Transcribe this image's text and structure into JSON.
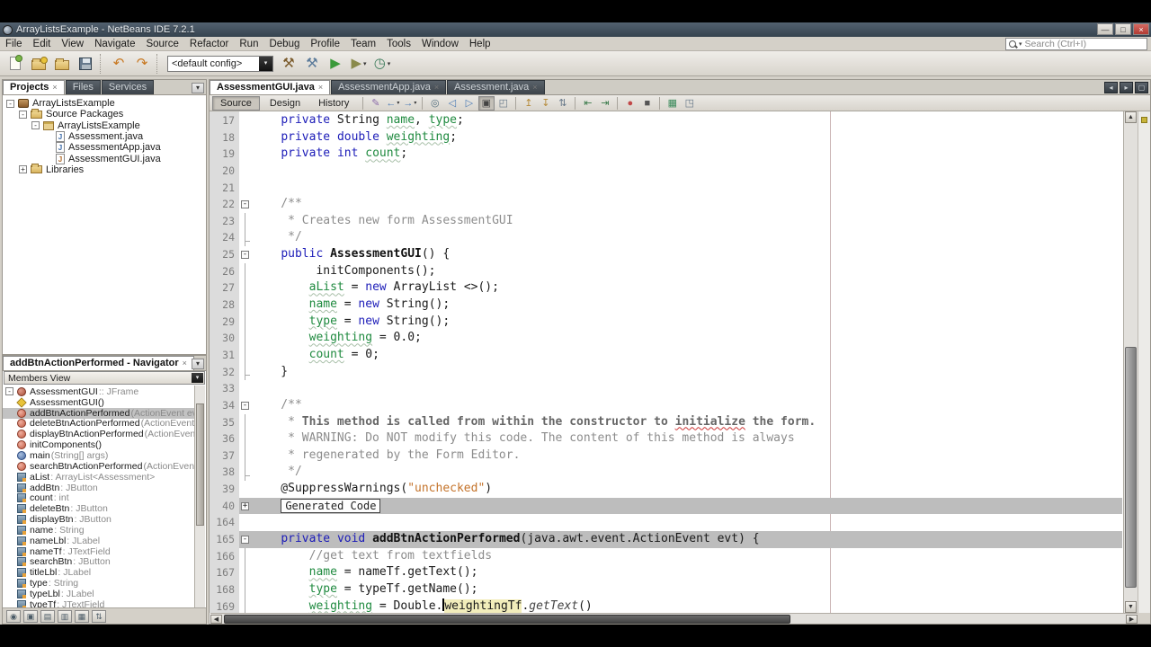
{
  "window": {
    "title": "ArrayListsExample - NetBeans IDE 7.2.1",
    "controls": {
      "minimize": "—",
      "restore": "□",
      "close": "×"
    }
  },
  "menu": {
    "items": [
      "File",
      "Edit",
      "View",
      "Navigate",
      "Source",
      "Refactor",
      "Run",
      "Debug",
      "Profile",
      "Team",
      "Tools",
      "Window",
      "Help"
    ]
  },
  "search": {
    "placeholder": "Search (Ctrl+I)"
  },
  "toolbar": {
    "config_value": "<default config>",
    "buttons": [
      {
        "name": "new-file",
        "css": "ci-newfile"
      },
      {
        "name": "new-project",
        "css": "ci-folder ci-newproj"
      },
      {
        "name": "open-project",
        "css": "ci-folder"
      },
      {
        "name": "save-all",
        "css": "ci-save"
      },
      {
        "sep": true
      },
      {
        "name": "undo",
        "glyph": "↶",
        "color": "#c87820"
      },
      {
        "name": "redo",
        "glyph": "↷",
        "color": "#c87820"
      },
      {
        "sep": true
      },
      {
        "config": true
      },
      {
        "name": "build-project",
        "glyph": "⚒",
        "color": "#7a5a2a"
      },
      {
        "name": "clean-build-project",
        "glyph": "⚒",
        "color": "#5a7a9a"
      },
      {
        "name": "run-project",
        "glyph": "▶",
        "color": "#3a9a3a"
      },
      {
        "name": "debug-project",
        "glyph": "▶",
        "color": "#8a8a4a",
        "dd": true
      },
      {
        "name": "profile-project",
        "glyph": "◷",
        "color": "#3a7a5a",
        "dd": true
      }
    ]
  },
  "projects_panel": {
    "tabs": [
      {
        "label": "Projects",
        "active": true
      },
      {
        "label": "Files",
        "active": false
      },
      {
        "label": "Services",
        "active": false
      }
    ],
    "tree": [
      {
        "label": "ArrayListsExample",
        "icon": "project",
        "depth": 0,
        "exp": "-"
      },
      {
        "label": "Source Packages",
        "icon": "folder",
        "depth": 1,
        "exp": "-"
      },
      {
        "label": "ArrayListsExample",
        "icon": "package",
        "depth": 2,
        "exp": "-"
      },
      {
        "label": "Assessment.java",
        "icon": "java",
        "depth": 3,
        "exp": null
      },
      {
        "label": "AssessmentApp.java",
        "icon": "java",
        "depth": 3,
        "exp": null
      },
      {
        "label": "AssessmentGUI.java",
        "icon": "java-form",
        "depth": 3,
        "exp": null
      },
      {
        "label": "Libraries",
        "icon": "folder",
        "depth": 1,
        "exp": "+"
      }
    ]
  },
  "navigator_panel": {
    "title": "addBtnActionPerformed - Navigator",
    "view_select": "Members View",
    "items": [
      {
        "name": "AssessmentGUI",
        "detail": " :: JFrame",
        "icon": "class",
        "depth": 0,
        "exp": "-",
        "selected": false
      },
      {
        "name": "AssessmentGUI()",
        "detail": "",
        "icon": "ctor",
        "depth": 1,
        "selected": false
      },
      {
        "name": "addBtnActionPerformed",
        "detail": "(ActionEvent evt)",
        "icon": "method",
        "depth": 1,
        "selected": true
      },
      {
        "name": "deleteBtnActionPerformed",
        "detail": "(ActionEvent evt)",
        "icon": "method",
        "depth": 1,
        "selected": false
      },
      {
        "name": "displayBtnActionPerformed",
        "detail": "(ActionEvent evt)",
        "icon": "method",
        "depth": 1,
        "selected": false
      },
      {
        "name": "initComponents()",
        "detail": "",
        "icon": "method",
        "depth": 1,
        "selected": false
      },
      {
        "name": "main",
        "detail": "(String[] args)",
        "icon": "method-static",
        "depth": 1,
        "selected": false
      },
      {
        "name": "searchBtnActionPerformed",
        "detail": "(ActionEvent evt)",
        "icon": "method",
        "depth": 1,
        "selected": false
      },
      {
        "name": "aList",
        "detail": " : ArrayList<Assessment>",
        "icon": "field",
        "depth": 1,
        "selected": false
      },
      {
        "name": "addBtn",
        "detail": " : JButton",
        "icon": "field",
        "depth": 1,
        "selected": false
      },
      {
        "name": "count",
        "detail": " : int",
        "icon": "field",
        "depth": 1,
        "selected": false
      },
      {
        "name": "deleteBtn",
        "detail": " : JButton",
        "icon": "field",
        "depth": 1,
        "selected": false
      },
      {
        "name": "displayBtn",
        "detail": " : JButton",
        "icon": "field",
        "depth": 1,
        "selected": false
      },
      {
        "name": "name",
        "detail": " : String",
        "icon": "field",
        "depth": 1,
        "selected": false
      },
      {
        "name": "nameLbl",
        "detail": " : JLabel",
        "icon": "field",
        "depth": 1,
        "selected": false
      },
      {
        "name": "nameTf",
        "detail": " : JTextField",
        "icon": "field",
        "depth": 1,
        "selected": false
      },
      {
        "name": "searchBtn",
        "detail": " : JButton",
        "icon": "field",
        "depth": 1,
        "selected": false
      },
      {
        "name": "titleLbl",
        "detail": " : JLabel",
        "icon": "field",
        "depth": 1,
        "selected": false
      },
      {
        "name": "type",
        "detail": " : String",
        "icon": "field",
        "depth": 1,
        "selected": false
      },
      {
        "name": "typeLbl",
        "detail": " : JLabel",
        "icon": "field",
        "depth": 1,
        "selected": false
      },
      {
        "name": "typeTf",
        "detail": " : JTextField",
        "icon": "field",
        "depth": 1,
        "selected": false
      }
    ],
    "filters": [
      {
        "name": "show-inherited-filter",
        "glyph": "◉"
      },
      {
        "name": "show-fields-filter",
        "glyph": "▣"
      },
      {
        "name": "show-static-filter",
        "glyph": "▤"
      },
      {
        "name": "show-public-filter",
        "glyph": "▥"
      },
      {
        "name": "show-non-public-filter",
        "glyph": "▦"
      },
      {
        "name": "sort-by-name",
        "glyph": "⇅"
      }
    ]
  },
  "editor": {
    "tabs": [
      {
        "label": "AssessmentGUI.java",
        "active": true
      },
      {
        "label": "AssessmentApp.java",
        "active": false
      },
      {
        "label": "Assessment.java",
        "active": false
      }
    ],
    "tab_buttons": [
      {
        "name": "scroll-tabs-left-button",
        "glyph": "◂"
      },
      {
        "name": "scroll-tabs-right-button",
        "glyph": "▸"
      },
      {
        "name": "maximize-window-button",
        "glyph": "▢"
      }
    ],
    "views": [
      {
        "label": "Source",
        "active": true
      },
      {
        "label": "Design",
        "active": false
      },
      {
        "label": "History",
        "active": false
      }
    ],
    "toolbar_icons": [
      {
        "name": "last-edit-location",
        "glyph": "✎",
        "color": "#8a6aa8"
      },
      {
        "name": "back",
        "glyph": "←",
        "color": "#4a7ab5",
        "dd": true
      },
      {
        "name": "forward",
        "glyph": "→",
        "color": "#4a7ab5",
        "dd": true
      },
      {
        "sep": true
      },
      {
        "name": "find-selection",
        "glyph": "◎",
        "color": "#55707f"
      },
      {
        "name": "find-previous",
        "glyph": "◁",
        "color": "#4a7ab5"
      },
      {
        "name": "find-next",
        "glyph": "▷",
        "color": "#4a7ab5"
      },
      {
        "name": "toggle-highlight-search",
        "glyph": "▣",
        "color": "#444",
        "pressed": true
      },
      {
        "name": "select-in-projects",
        "glyph": "◰",
        "color": "#667788"
      },
      {
        "sep": true
      },
      {
        "name": "previous-bookmark",
        "glyph": "↥",
        "color": "#b58a3a"
      },
      {
        "name": "next-bookmark",
        "glyph": "↧",
        "color": "#b58a3a"
      },
      {
        "name": "toggle-bookmark",
        "glyph": "⇅",
        "color": "#667788"
      },
      {
        "sep": true
      },
      {
        "name": "shift-line-left",
        "glyph": "⇤",
        "color": "#3a7a4a"
      },
      {
        "name": "shift-line-right",
        "glyph": "⇥",
        "color": "#3a7a4a"
      },
      {
        "sep": true
      },
      {
        "name": "record-macro",
        "glyph": "●",
        "color": "#c14848"
      },
      {
        "name": "stop-macro",
        "glyph": "■",
        "color": "#555555"
      },
      {
        "sep": true
      },
      {
        "name": "diff-to-tracked",
        "glyph": "▦",
        "color": "#3a8a5a"
      },
      {
        "name": "split-document",
        "glyph": "◳",
        "color": "#667788"
      }
    ],
    "code": {
      "lines": [
        {
          "n": 17,
          "seg": [
            [
              "    ",
              "p"
            ],
            [
              "private",
              "kw"
            ],
            [
              " String ",
              "p"
            ],
            [
              "name",
              "fld"
            ],
            [
              ", ",
              "p"
            ],
            [
              "type",
              "fld"
            ],
            [
              ";",
              "p"
            ]
          ]
        },
        {
          "n": 18,
          "seg": [
            [
              "    ",
              "p"
            ],
            [
              "private",
              "kw"
            ],
            [
              " ",
              "p"
            ],
            [
              "double",
              "kw"
            ],
            [
              " ",
              "p"
            ],
            [
              "weighting",
              "fld"
            ],
            [
              ";",
              "p"
            ]
          ]
        },
        {
          "n": 19,
          "seg": [
            [
              "    ",
              "p"
            ],
            [
              "private",
              "kw"
            ],
            [
              " ",
              "p"
            ],
            [
              "int",
              "kw"
            ],
            [
              " ",
              "p"
            ],
            [
              "count",
              "fld"
            ],
            [
              ";",
              "p"
            ]
          ]
        },
        {
          "n": 20,
          "seg": []
        },
        {
          "n": 21,
          "seg": []
        },
        {
          "n": 22,
          "f": "o",
          "seg": [
            [
              "    /**",
              "cmt"
            ]
          ]
        },
        {
          "n": 23,
          "fl": 1,
          "seg": [
            [
              "     * Creates new form AssessmentGUI",
              "cmt"
            ]
          ]
        },
        {
          "n": 24,
          "fl": 1,
          "fe": 1,
          "seg": [
            [
              "     */",
              "cmt"
            ]
          ]
        },
        {
          "n": 25,
          "f": "o",
          "seg": [
            [
              "    ",
              "p"
            ],
            [
              "public",
              "kw"
            ],
            [
              " ",
              "p"
            ],
            [
              "AssessmentGUI",
              "b"
            ],
            [
              "() {",
              "p"
            ]
          ]
        },
        {
          "n": 26,
          "fl": 1,
          "seg": [
            [
              "         initComponents();",
              "p"
            ]
          ]
        },
        {
          "n": 27,
          "fl": 1,
          "seg": [
            [
              "        ",
              "p"
            ],
            [
              "aList",
              "fld"
            ],
            [
              " = ",
              "p"
            ],
            [
              "new",
              "kw"
            ],
            [
              " ArrayList <>();",
              "p"
            ]
          ]
        },
        {
          "n": 28,
          "fl": 1,
          "seg": [
            [
              "        ",
              "p"
            ],
            [
              "name",
              "fld"
            ],
            [
              " = ",
              "p"
            ],
            [
              "new",
              "kw"
            ],
            [
              " String();",
              "p"
            ]
          ]
        },
        {
          "n": 29,
          "fl": 1,
          "seg": [
            [
              "        ",
              "p"
            ],
            [
              "type",
              "fld"
            ],
            [
              " = ",
              "p"
            ],
            [
              "new",
              "kw"
            ],
            [
              " String();",
              "p"
            ]
          ]
        },
        {
          "n": 30,
          "fl": 1,
          "seg": [
            [
              "        ",
              "p"
            ],
            [
              "weighting",
              "fld"
            ],
            [
              " = 0.0;",
              "p"
            ]
          ]
        },
        {
          "n": 31,
          "fl": 1,
          "seg": [
            [
              "        ",
              "p"
            ],
            [
              "count",
              "fld"
            ],
            [
              " = 0;",
              "p"
            ]
          ]
        },
        {
          "n": 32,
          "fl": 1,
          "fe": 1,
          "seg": [
            [
              "    }",
              "p"
            ]
          ]
        },
        {
          "n": 33,
          "seg": []
        },
        {
          "n": 34,
          "f": "o",
          "seg": [
            [
              "    /**",
              "cmt"
            ]
          ]
        },
        {
          "n": 35,
          "fl": 1,
          "seg": [
            [
              "     * ",
              "cmt"
            ],
            [
              "This method is called from within the constructor to ",
              "cb"
            ],
            [
              "initialize",
              "cb sq"
            ],
            [
              " the form.",
              "cb"
            ]
          ]
        },
        {
          "n": 36,
          "fl": 1,
          "seg": [
            [
              "     * WARNING: Do NOT modify this code. The content of this method is always",
              "cmt"
            ]
          ]
        },
        {
          "n": 37,
          "fl": 1,
          "seg": [
            [
              "     * regenerated by the Form Editor.",
              "cmt"
            ]
          ]
        },
        {
          "n": 38,
          "fl": 1,
          "fe": 1,
          "seg": [
            [
              "     */",
              "cmt"
            ]
          ]
        },
        {
          "n": 39,
          "seg": [
            [
              "    @SuppressWarnings(",
              "p"
            ],
            [
              "\"unchecked\"",
              "str"
            ],
            [
              ")",
              "p"
            ]
          ]
        },
        {
          "n": 40,
          "f": "c",
          "bar": 1,
          "seg": [
            [
              "    ",
              "p"
            ],
            [
              "Generated Code",
              "box"
            ]
          ]
        },
        {
          "n": 164,
          "seg": []
        },
        {
          "n": 165,
          "f": "o",
          "bar": 1,
          "seg": [
            [
              "    ",
              "p"
            ],
            [
              "private",
              "kw"
            ],
            [
              " ",
              "p"
            ],
            [
              "void",
              "kw"
            ],
            [
              " ",
              "p"
            ],
            [
              "addBtnActionPerformed",
              "b"
            ],
            [
              "(java.awt.event.ActionEvent evt) {",
              "p"
            ]
          ]
        },
        {
          "n": 166,
          "fl": 1,
          "seg": [
            [
              "        //get text from textfields",
              "cmt"
            ]
          ]
        },
        {
          "n": 167,
          "fl": 1,
          "seg": [
            [
              "        ",
              "p"
            ],
            [
              "name",
              "fld"
            ],
            [
              " = nameTf.getText();",
              "p"
            ]
          ]
        },
        {
          "n": 168,
          "fl": 1,
          "seg": [
            [
              "        ",
              "p"
            ],
            [
              "type",
              "fld"
            ],
            [
              " = typeTf.getName();",
              "p"
            ]
          ]
        },
        {
          "n": 169,
          "fl": 1,
          "seg": [
            [
              "        ",
              "p"
            ],
            [
              "weighting",
              "fld"
            ],
            [
              " = Double.",
              "p"
            ],
            [
              "",
              "cur"
            ],
            [
              "weightingTf",
              "hl"
            ],
            [
              ".",
              "p"
            ],
            [
              "getText",
              "it"
            ],
            [
              "()",
              "p"
            ]
          ]
        }
      ]
    }
  },
  "colors": {
    "titlebar": "#3c4a59",
    "close_button": "#b13c34",
    "guard_bar": "#bdbdbd",
    "occurrence_highlight": "#f2edbb",
    "keyword": "#1c1cb8",
    "field": "#1f8a3f",
    "comment": "#8c8c8c",
    "string": "#c4732a",
    "error_mark": "#c8b43a"
  }
}
